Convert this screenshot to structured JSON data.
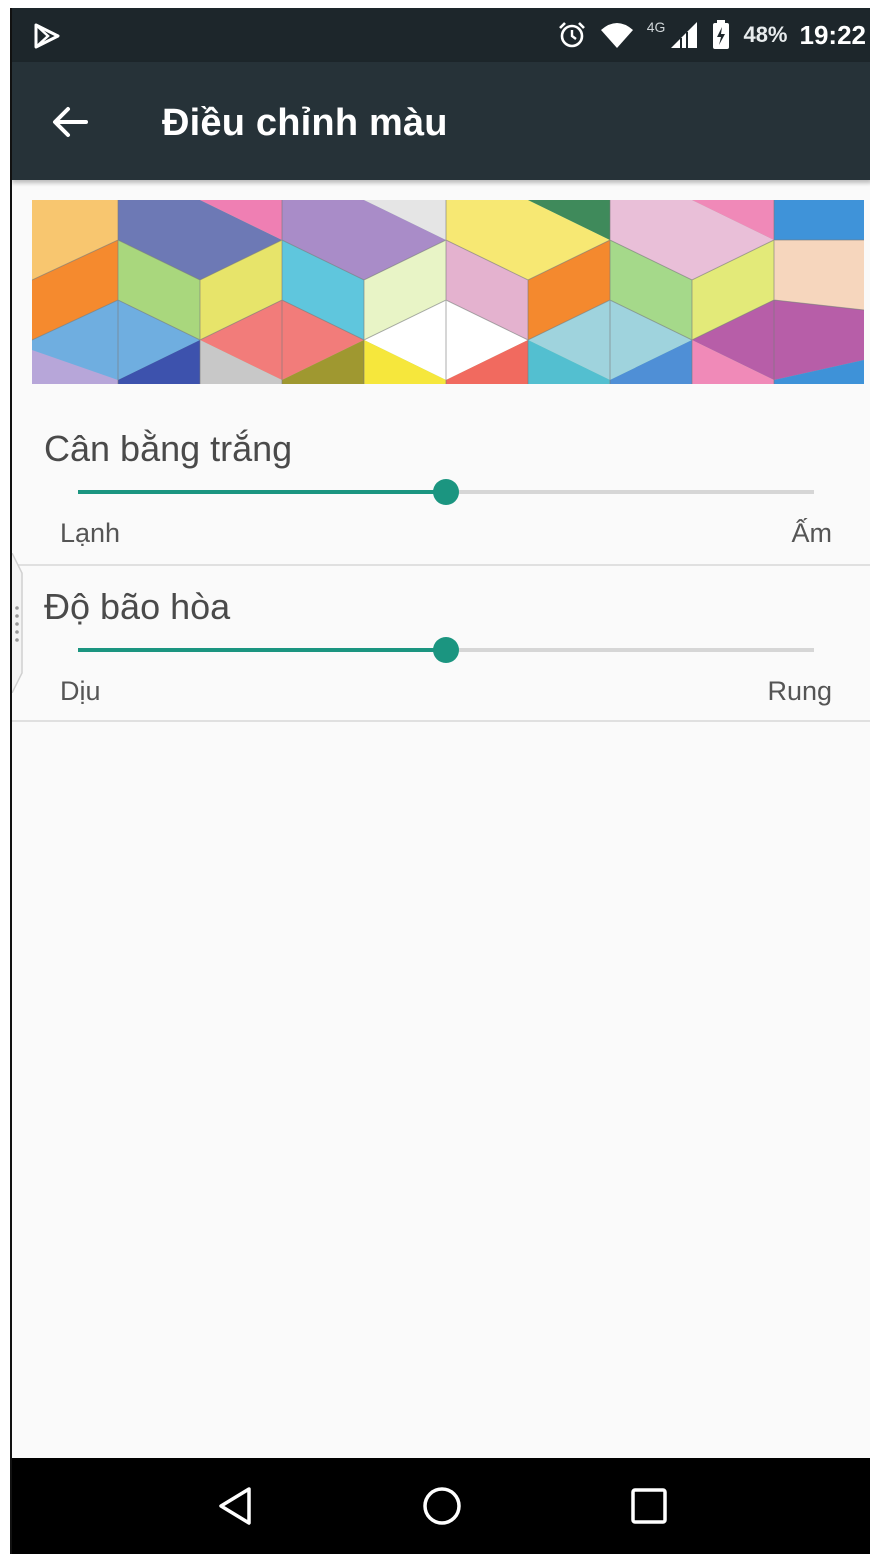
{
  "status_bar": {
    "network_type": "4G",
    "battery_percent": "48%",
    "time": "19:22",
    "icons": [
      "play-store-icon",
      "alarm-icon",
      "wifi-icon",
      "signal-icon",
      "battery-charging-icon"
    ]
  },
  "app_bar": {
    "title": "Điều chỉnh màu",
    "back_icon": "arrow-left-icon"
  },
  "white_balance": {
    "title": "Cân bằng trắng",
    "min_label": "Lạnh",
    "max_label": "Ấm",
    "value": 0.5
  },
  "saturation": {
    "title": "Độ bão hòa",
    "min_label": "Dịu",
    "max_label": "Rung",
    "value": 0.5
  },
  "colors": {
    "accent": "#1b9580",
    "app_bar": "#263238",
    "status_bar": "#1d262b"
  },
  "nav_bar": {
    "back_icon": "triangle-back-icon",
    "home_icon": "circle-home-icon",
    "recents_icon": "square-recents-icon"
  }
}
